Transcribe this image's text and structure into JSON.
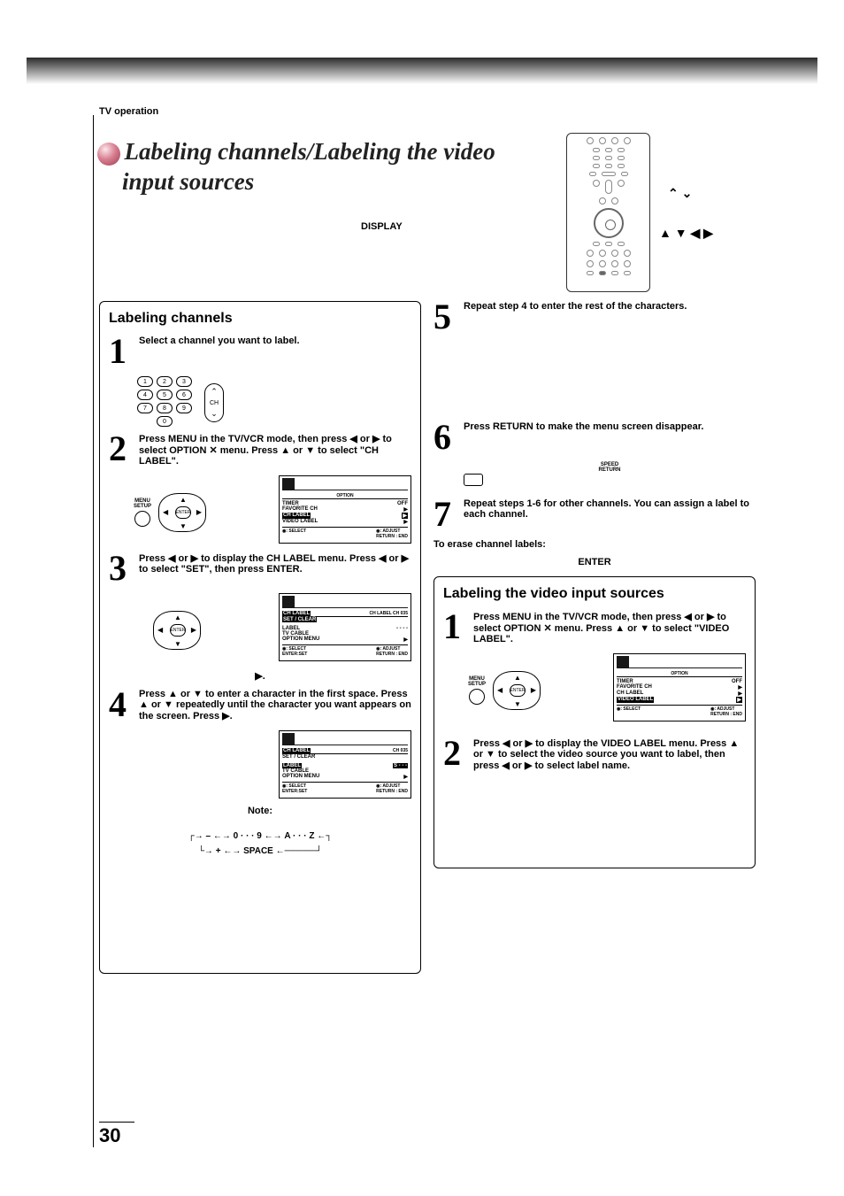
{
  "section_header": "TV operation",
  "title_line1": "Labeling channels/Labeling the video",
  "title_line2": "input sources",
  "display_label": "DISPLAY",
  "remote_arrows_right": "▲ ▼ ◀ ▶",
  "box1_title": "Labeling channels",
  "box2_title": "Labeling the video input sources",
  "step1": "Select a channel you want to label.",
  "keys": [
    "1",
    "2",
    "3",
    "4",
    "5",
    "6",
    "7",
    "8",
    "9",
    "0"
  ],
  "ch_label": "CH",
  "step2": "Press MENU in the TV/VCR mode, then press ◀ or ▶ to select OPTION ✕ menu. Press ▲ or ▼ to select \"CH LABEL\".",
  "menu_setup": "MENU\nSETUP",
  "enter_btn": "ENTER",
  "osd_option": "OPTION",
  "osd_timer": "TIMER",
  "osd_off": "OFF",
  "osd_fav": "FAVORITE CH",
  "osd_chlabel": "CH LABEL",
  "osd_videolabel": "VIDEO LABEL",
  "osd_tri": "▶",
  "osd_select": "◉: SELECT",
  "osd_adjust": "◉: ADJUST",
  "osd_return_end": "RETURN : END",
  "osd_enter_set": "ENTER:SET",
  "step3": "Press ◀ or ▶ to display the CH LABEL menu. Press ◀ or ▶ to select \"SET\", then press ENTER.",
  "osd3_head": "CH LABEL            CH 035",
  "osd3_setclear": "SET / CLEAR",
  "osd3_label": "LABEL",
  "osd3_dashes": "- - - -",
  "osd3_tvcable": "TV CABLE",
  "osd3_optmenu": "OPTION MENU",
  "step3_note": "▶.",
  "step4": "Press ▲ or ▼ to enter a character in the first space. Press ▲ or ▼ repeatedly until the character you want appears on the screen. Press ▶.",
  "osd4_label_val": "S - - -",
  "note_label": "Note:",
  "cycle_minus": "–",
  "cycle_09": "0 · · · 9",
  "cycle_az": "A · · · Z",
  "cycle_plus": "+",
  "cycle_space": "SPACE",
  "step5": "Repeat step 4 to enter the rest of the characters.",
  "step6": "Press RETURN to make the menu screen disappear.",
  "return_label": "SPEED\nRETURN",
  "step7": "Repeat steps 1-6 for other channels. You can assign a label to each channel.",
  "erase": "To erase channel labels:",
  "enter_center": "ENTER",
  "step_b1": "Press MENU in the TV/VCR mode, then press ◀ or ▶ to select OPTION ✕ menu. Press ▲ or ▼ to select \"VIDEO LABEL\".",
  "step_b2": "Press ◀ or ▶ to display the VIDEO LABEL menu. Press ▲ or ▼ to select the video source you want to label, then press ◀ or ▶ to select label name.",
  "page_number": "30"
}
